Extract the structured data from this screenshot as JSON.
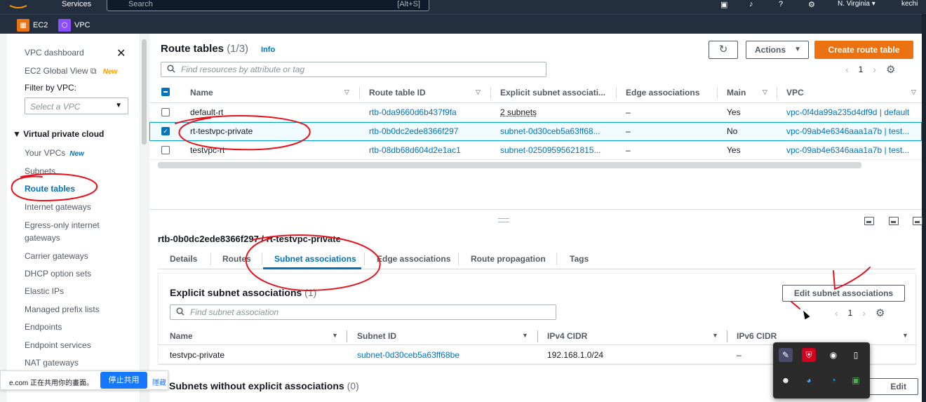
{
  "topbar": {
    "services": "Services",
    "search_placeholder": "Search",
    "search_shortcut": "[Alt+S]",
    "region": "N. Virginia ▾",
    "user": "kechi"
  },
  "service_bar": {
    "items": [
      {
        "label": "EC2",
        "color": "#ec7211"
      },
      {
        "label": "VPC",
        "color": "#8c4fff"
      }
    ]
  },
  "sidebar": {
    "top_items": [
      {
        "label": "VPC dashboard"
      },
      {
        "label": "EC2 Global View",
        "badge": "New"
      }
    ],
    "filter_label": "Filter by VPC:",
    "filter_placeholder": "Select a VPC",
    "section": "Virtual private cloud",
    "items": [
      {
        "label": "Your VPCs",
        "badge": "New"
      },
      {
        "label": "Subnets"
      },
      {
        "label": "Route tables",
        "active": true
      },
      {
        "label": "Internet gateways"
      },
      {
        "label": "Egress-only internet"
      },
      {
        "label": "gateways"
      },
      {
        "label": "Carrier gateways"
      },
      {
        "label": "DHCP option sets"
      },
      {
        "label": "Elastic IPs"
      },
      {
        "label": "Managed prefix lists"
      },
      {
        "label": "Endpoints"
      },
      {
        "label": "Endpoint services"
      },
      {
        "label": "NAT gateways"
      }
    ]
  },
  "route_tables": {
    "title": "Route tables",
    "count": "(1/3)",
    "info": "Info",
    "actions_label": "Actions",
    "create_label": "Create route table",
    "search_placeholder": "Find resources by attribute or tag",
    "page": "1",
    "columns": [
      "Name",
      "Route table ID",
      "Explicit subnet associati...",
      "Edge associations",
      "Main",
      "VPC"
    ],
    "rows": [
      {
        "name": "default-rt",
        "id": "rtb-0da9660d6b437f9fa",
        "subnets": "2 subnets",
        "edge": "–",
        "main": "Yes",
        "vpc": "vpc-0f4da99a235d4df9d | default",
        "selected": false
      },
      {
        "name": "rt-testvpc-private",
        "id": "rtb-0b0dc2ede8366f297",
        "subnets": "subnet-0d30ceb5a63ff68...",
        "edge": "–",
        "main": "No",
        "vpc": "vpc-09ab4e6346aaa1a7b | test...",
        "selected": true
      },
      {
        "name": "testvpc-rt",
        "id": "rtb-08db68d604d2e1ac1",
        "subnets": "subnet-02509595621815...",
        "edge": "–",
        "main": "Yes",
        "vpc": "vpc-09ab4e6346aaa1a7b | test...",
        "selected": false
      }
    ]
  },
  "detail": {
    "title": "rtb-0b0dc2ede8366f297 / rt-testvpc-private",
    "tabs": [
      "Details",
      "Routes",
      "Subnet associations",
      "Edge associations",
      "Route propagation",
      "Tags"
    ],
    "active_tab": "Subnet associations",
    "explicit": {
      "title": "Explicit subnet associations",
      "count": "(1)",
      "edit_label": "Edit subnet associations",
      "search_placeholder": "Find subnet association",
      "page": "1",
      "columns": [
        "Name",
        "Subnet ID",
        "IPv4 CIDR",
        "IPv6 CIDR"
      ],
      "rows": [
        {
          "name": "testvpc-private",
          "subnet_id": "subnet-0d30ceb5a63ff68be",
          "ipv4": "192.168.1.0/24",
          "ipv6": "–"
        }
      ]
    },
    "without": {
      "title": "Subnets without explicit associations",
      "count": "(0)",
      "button_label": "Edit subnet associations"
    }
  },
  "share_bar": {
    "text": "e.com 正在共用你的畫面。",
    "stop_label": "停止共用",
    "hide_label": "隱藏"
  },
  "colors": {
    "aws_orange": "#ec7211",
    "link_blue": "#0073bb",
    "header_navy": "#232f3e",
    "annotation_red": "#e8101a"
  }
}
